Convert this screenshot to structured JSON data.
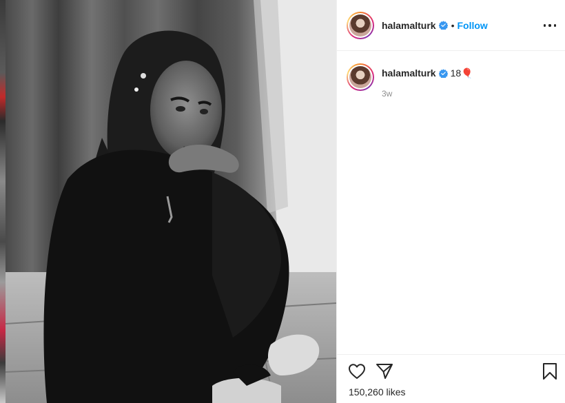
{
  "post": {
    "username": "halamalturk",
    "separator": "•",
    "follow_label": "Follow",
    "caption_user": "halamalturk",
    "caption_text": "18🎈",
    "time_ago": "3w",
    "likes": "150,260 likes"
  },
  "icons": {
    "verified": "verified-badge-icon",
    "more": "more-options-icon",
    "like": "heart-icon",
    "share": "share-icon",
    "save": "bookmark-icon"
  },
  "colors": {
    "accent": "#0095f6",
    "text": "#262626",
    "muted": "#8e8e8e",
    "divider": "#efefef"
  }
}
